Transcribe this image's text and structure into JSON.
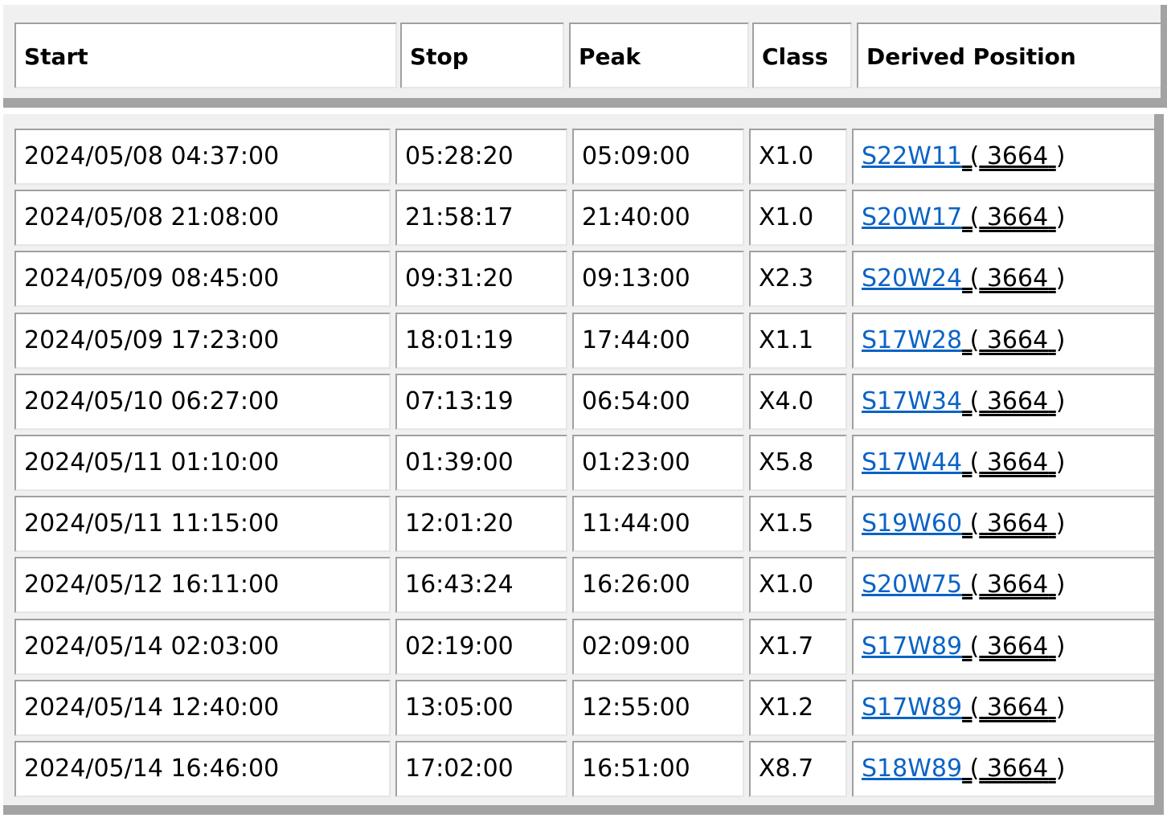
{
  "header": {
    "columns": [
      "Start",
      "Stop",
      "Peak",
      "Class",
      "Derived Position"
    ]
  },
  "rows": [
    {
      "start": "2024/05/08 04:37:00",
      "stop": "05:28:20",
      "peak": "05:09:00",
      "class": "X1.0",
      "position": "S22W11",
      "region": " 3664"
    },
    {
      "start": "2024/05/08 21:08:00",
      "stop": "21:58:17",
      "peak": "21:40:00",
      "class": "X1.0",
      "position": "S20W17",
      "region": " 3664"
    },
    {
      "start": "2024/05/09 08:45:00",
      "stop": "09:31:20",
      "peak": "09:13:00",
      "class": "X2.3",
      "position": "S20W24",
      "region": " 3664"
    },
    {
      "start": "2024/05/09 17:23:00",
      "stop": "18:01:19",
      "peak": "17:44:00",
      "class": "X1.1",
      "position": "S17W28",
      "region": " 3664"
    },
    {
      "start": "2024/05/10 06:27:00",
      "stop": "07:13:19",
      "peak": "06:54:00",
      "class": "X4.0",
      "position": "S17W34",
      "region": " 3664"
    },
    {
      "start": "2024/05/11 01:10:00",
      "stop": "01:39:00",
      "peak": "01:23:00",
      "class": "X5.8",
      "position": "S17W44",
      "region": " 3664"
    },
    {
      "start": "2024/05/11 11:15:00",
      "stop": "12:01:20",
      "peak": "11:44:00",
      "class": "X1.5",
      "position": "S19W60",
      "region": " 3664"
    },
    {
      "start": "2024/05/12 16:11:00",
      "stop": "16:43:24",
      "peak": "16:26:00",
      "class": "X1.0",
      "position": "S20W75",
      "region": " 3664"
    },
    {
      "start": "2024/05/14 02:03:00",
      "stop": "02:19:00",
      "peak": "02:09:00",
      "class": "X1.7",
      "position": "S17W89",
      "region": " 3664"
    },
    {
      "start": "2024/05/14 12:40:00",
      "stop": "13:05:00",
      "peak": "12:55:00",
      "class": "X1.2",
      "position": "S17W89",
      "region": " 3664"
    },
    {
      "start": "2024/05/14 16:46:00",
      "stop": "17:02:00",
      "peak": "16:51:00",
      "class": "X8.7",
      "position": "S18W89",
      "region": " 3664"
    }
  ]
}
